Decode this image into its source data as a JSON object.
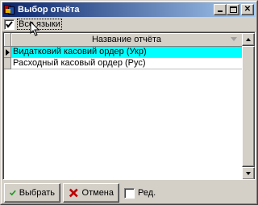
{
  "window": {
    "title": "Выбор отчёта",
    "controls": {
      "minimize": "minimize",
      "maximize": "maximize",
      "close": "✕"
    }
  },
  "filter": {
    "all_languages_label": "Все языки",
    "all_languages_checked": true
  },
  "grid": {
    "column_header": "Название отчёта",
    "rows": [
      {
        "label": "Видатковий касовий ордер (Укр)",
        "selected": true
      },
      {
        "label": "Расходный касовый ордер (Рус)",
        "selected": false
      }
    ],
    "selected_color": "#00ffff"
  },
  "footer": {
    "ok_label": "Выбрать",
    "cancel_label": "Отмена",
    "edit_label": "Ред.",
    "edit_checked": false
  },
  "colors": {
    "title_gradient_start": "#0a246a",
    "title_gradient_end": "#a6caf0",
    "ok_icon": "#1a9a1a",
    "cancel_icon": "#c00000"
  }
}
